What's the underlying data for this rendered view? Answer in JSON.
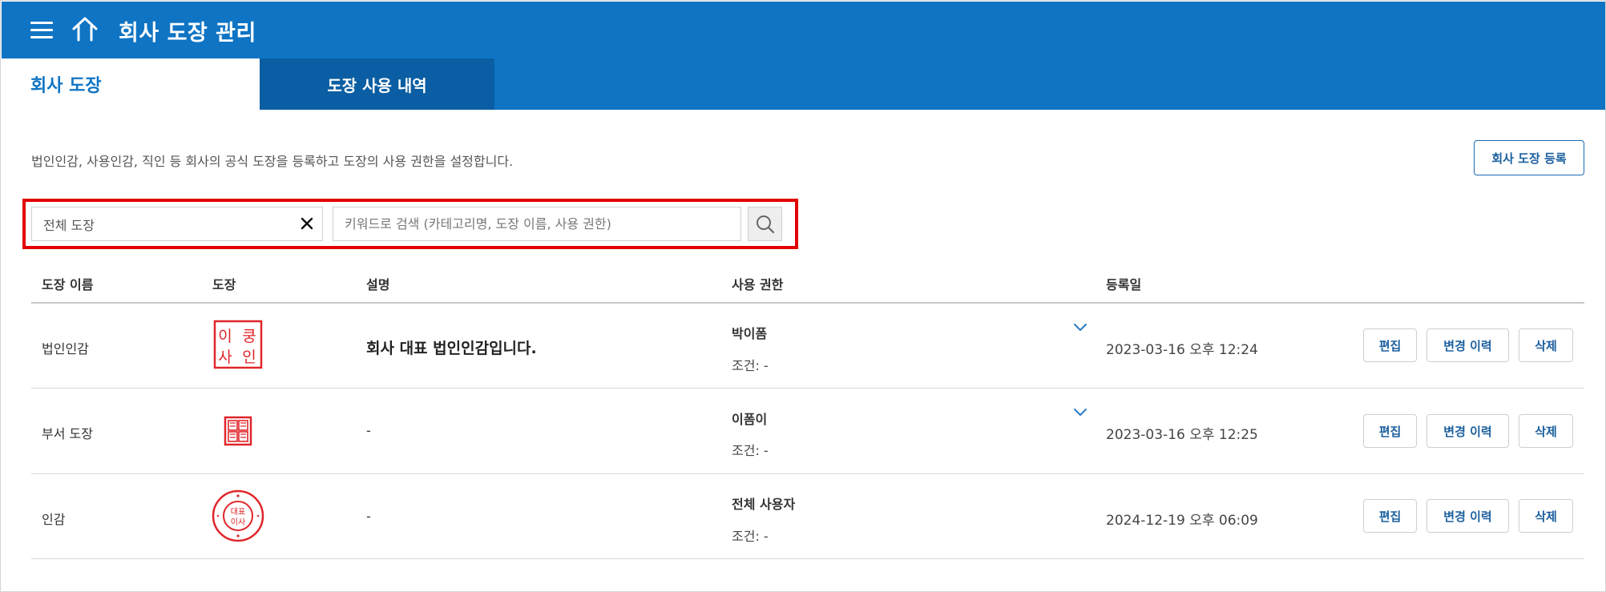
{
  "header": {
    "title": "회사 도장 관리",
    "bg_color": "#0f74c4",
    "menu_icon": "hamburger-menu-icon",
    "home_icon": "home-icon"
  },
  "tabs": [
    {
      "label": "회사 도장",
      "active": true
    },
    {
      "label": "도장 사용 내역",
      "active": false
    }
  ],
  "description": "법인인감, 사용인감, 직인 등 회사의 공식 도장을 등록하고 도장의 사용 권한을 설정합니다.",
  "register_button": "회사 도장 등록",
  "search": {
    "filter_value": "전체 도장",
    "placeholder": "키워드로 검색 (카테고리명, 도장 이름, 사용 권한)",
    "clear_icon": "close-icon",
    "search_icon": "search-icon"
  },
  "table": {
    "columns": [
      "도장 이름",
      "도장",
      "설명",
      "사용 권한",
      "등록일"
    ],
    "rows": [
      {
        "name": "법인인감",
        "stamp_text": [
          "이",
          "쿵",
          "사",
          "인"
        ],
        "description": "회사 대표 법인인감입니다.",
        "permission": "박이폼",
        "condition": "조건: -",
        "date": "2023-03-16 오후 12:24",
        "has_dropdown": true
      },
      {
        "name": "부서 도장",
        "description": "-",
        "permission": "이폼이",
        "condition": "조건: -",
        "date": "2023-03-16 오후 12:25",
        "has_dropdown": true
      },
      {
        "name": "인감",
        "stamp_text": [
          "대표",
          "이사"
        ],
        "description": "-",
        "permission": "전체 사용자",
        "condition": "조건: -",
        "date": "2024-12-19 오후 06:09",
        "has_dropdown": false
      }
    ],
    "actions": {
      "edit": "편집",
      "history": "변경 이력",
      "delete": "삭제"
    }
  },
  "colors": {
    "accent": "#0f74c4",
    "tab_inactive": "#0b5ea3",
    "highlight_box": "#e20000",
    "stamp_red": "#e0262b"
  }
}
